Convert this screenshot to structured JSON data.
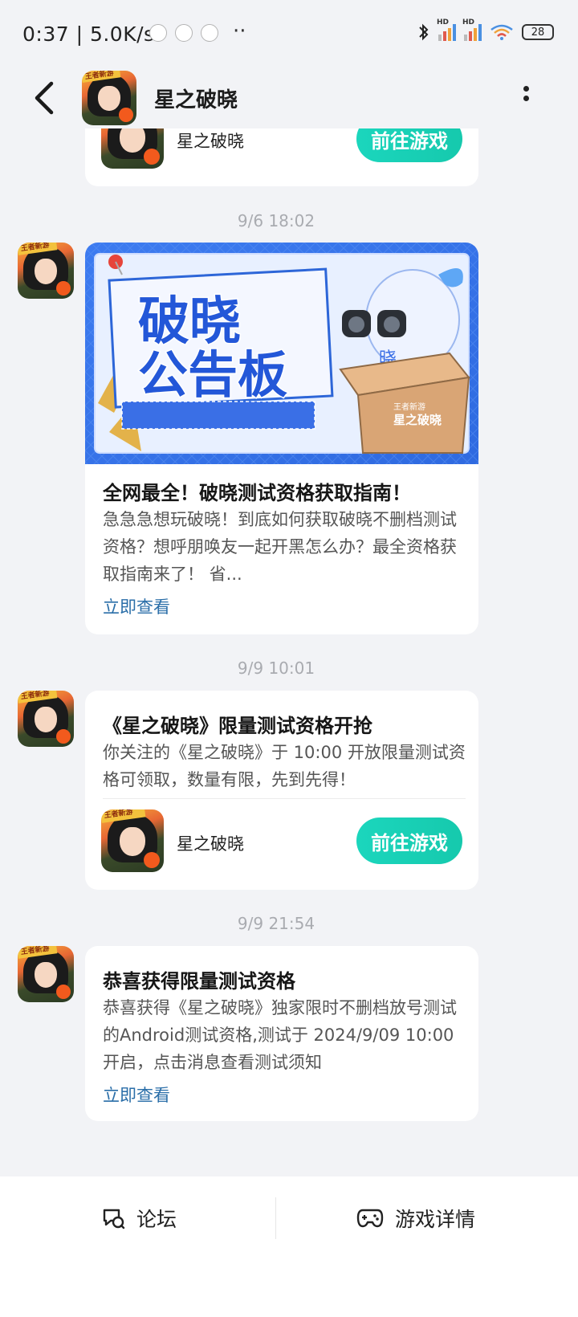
{
  "status_bar": {
    "time_speed": "0:37 | 5.0K/s",
    "dots": "··",
    "signal1_label": "HD",
    "signal2_label": "HD",
    "battery": "28"
  },
  "header": {
    "title": "星之破晓",
    "avatar_text": "王者新游"
  },
  "top_partial_card": {
    "game_name": "星之破晓",
    "button": "前往游戏"
  },
  "messages": [
    {
      "timestamp": "9/6  18:02",
      "banner_title_line1": "破晓",
      "banner_title_line2": "公告板",
      "box_label_small": "王者新游",
      "box_label_big": "星之破晓",
      "mascot_label": "晓",
      "title": "全网最全！破晓测试资格获取指南！",
      "body": "急急急想玩破晓！到底如何获取破晓不删档测试资格？想呼朋唤友一起开黑怎么办？最全资格获取指南来了！ 省...",
      "link": "立即查看"
    },
    {
      "timestamp": "9/9  10:01",
      "title": "《星之破晓》限量测试资格开抢",
      "body": "你关注的《星之破晓》于 10:00 开放限量测试资格可领取，数量有限，先到先得！",
      "game_name": "星之破晓",
      "button": "前往游戏"
    },
    {
      "timestamp": "9/9  21:54",
      "title": "恭喜获得限量测试资格",
      "body": "恭喜获得《星之破晓》独家限时不删档放号测试的Android测试资格,测试于 2024/9/09 10:00 开启，点击消息查看测试须知",
      "link": "立即查看"
    }
  ],
  "bottom_bar": {
    "forum": "论坛",
    "game_detail": "游戏详情"
  },
  "colors": {
    "accent_teal": "#19d1b6",
    "link_blue": "#2a6ea8",
    "page_bg": "#f2f3f6"
  }
}
